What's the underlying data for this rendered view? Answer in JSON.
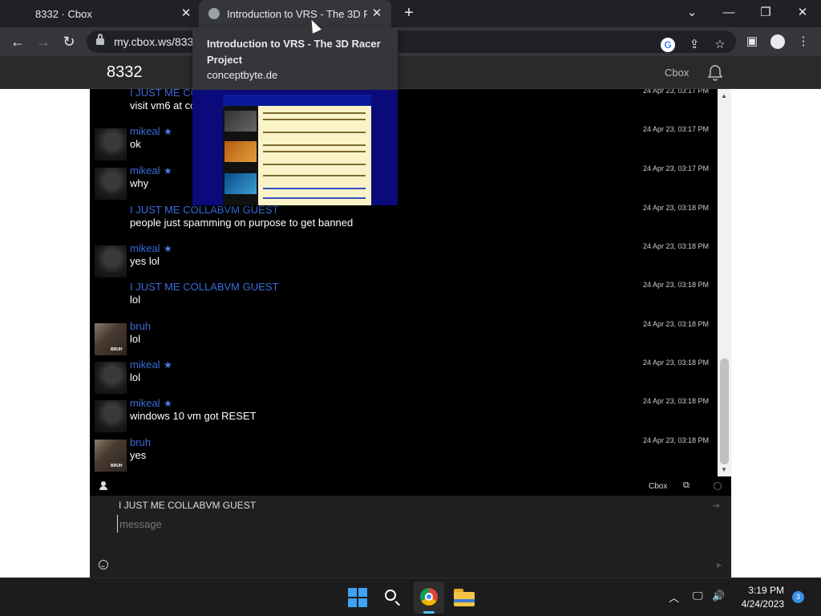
{
  "browser": {
    "tabs": [
      {
        "title": "8332 · Cbox"
      },
      {
        "title": "Introduction to VRS - The 3D Racer Project"
      }
    ],
    "close_glyph": "✕",
    "new_tab_glyph": "+",
    "url": "my.cbox.ws/8332",
    "hover_card": {
      "title": "Introduction to VRS - The 3D Racer Project",
      "domain": "conceptbyte.de"
    }
  },
  "cbox": {
    "title": "8332",
    "brand": "Cbox",
    "messages": [
      {
        "user": "I JUST ME COLLABVM GUEST",
        "starred": false,
        "avatar": "none",
        "text": "visit vm6 at collabvm",
        "time": "24 Apr 23, 03:17 PM"
      },
      {
        "user": "mikeal",
        "starred": true,
        "avatar": "dark",
        "text": "ok",
        "time": "24 Apr 23, 03:17 PM"
      },
      {
        "user": "mikeal",
        "starred": true,
        "avatar": "dark",
        "text": "why",
        "time": "24 Apr 23, 03:17 PM"
      },
      {
        "user": "I JUST ME COLLABVM GUEST",
        "starred": false,
        "avatar": "none",
        "text": "people just spamming on purpose to get banned",
        "time": "24 Apr 23, 03:18 PM"
      },
      {
        "user": "mikeal",
        "starred": true,
        "avatar": "dark",
        "text": "yes lol",
        "time": "24 Apr 23, 03:18 PM"
      },
      {
        "user": "I JUST ME COLLABVM GUEST",
        "starred": false,
        "avatar": "none",
        "text": "lol",
        "time": "24 Apr 23, 03:18 PM"
      },
      {
        "user": "bruh",
        "starred": false,
        "avatar": "bruh",
        "text": "lol",
        "time": "24 Apr 23, 03:18 PM"
      },
      {
        "user": "mikeal",
        "starred": true,
        "avatar": "dark",
        "text": "lol",
        "time": "24 Apr 23, 03:18 PM"
      },
      {
        "user": "mikeal",
        "starred": true,
        "avatar": "dark",
        "text": "windows 10 vm got RESET",
        "time": "24 Apr 23, 03:18 PM"
      },
      {
        "user": "bruh",
        "starred": false,
        "avatar": "bruh",
        "text": "yes",
        "time": "24 Apr 23, 03:18 PM"
      }
    ],
    "bar_brand": "Cbox",
    "name_field": "I JUST ME COLLABVM GUEST",
    "message_placeholder": "message"
  },
  "taskbar": {
    "time": "3:19 PM",
    "date": "4/24/2023",
    "notification_count": "3"
  },
  "colors": {
    "username": "#3a6bd8",
    "chat_bg": "#000000",
    "accent": "#3ea3f5"
  }
}
